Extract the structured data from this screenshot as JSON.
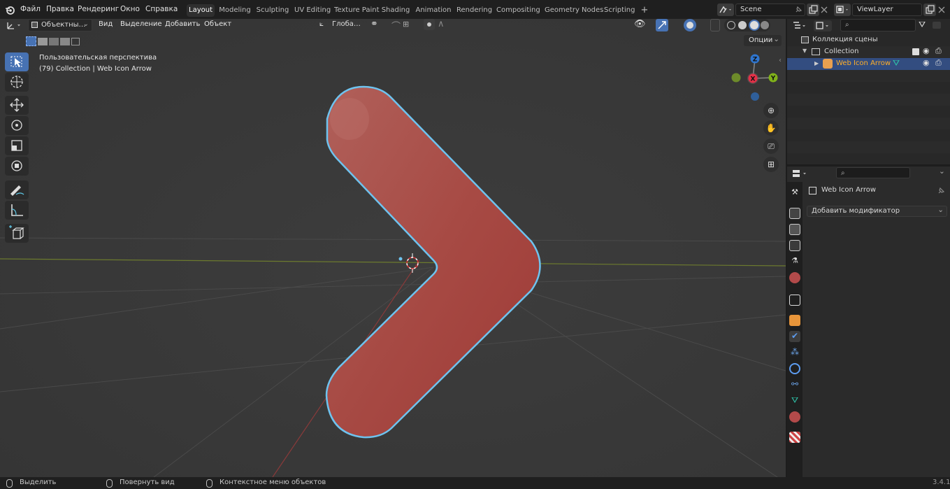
{
  "menu": {
    "file": "Файл",
    "edit": "Правка",
    "render": "Рендеринг",
    "window": "Окно",
    "help": "Справка"
  },
  "workspaces": [
    "Layout",
    "Modeling",
    "Sculpting",
    "UV Editing",
    "Texture Paint",
    "Shading",
    "Animation",
    "Rendering",
    "Compositing",
    "Geometry Nodes",
    "Scripting"
  ],
  "workspace_add": "+",
  "scene": {
    "name": "Scene"
  },
  "view_layer": {
    "name": "ViewLayer"
  },
  "viewport": {
    "mode": "Объектны…",
    "menus": {
      "view": "Вид",
      "select": "Выделение",
      "add": "Добавить",
      "object": "Объект"
    },
    "orientation": "Глоба…",
    "info_line1": "Пользовательская перспектива",
    "info_line2": "(79) Collection | Web Icon Arrow",
    "options": "Опции",
    "gizmo": {
      "z": "Z",
      "y": "Y",
      "x": "X"
    },
    "object_color": "#a8433f",
    "selection_outline_color": "#6ec3ef"
  },
  "outliner": {
    "scene_collection": "Коллекция сцены",
    "collection": "Collection",
    "object": "Web Icon Arrow"
  },
  "properties": {
    "object_name": "Web Icon Arrow",
    "add_modifier": "Добавить модификатор"
  },
  "status": {
    "select": "Выделить",
    "rotate": "Повернуть вид",
    "context": "Контекстное меню объектов",
    "version": "3.4.1"
  },
  "colors": {
    "accent": "#4772b3",
    "active_object_text": "#ffaf29",
    "bg": "#1d1d1d"
  }
}
